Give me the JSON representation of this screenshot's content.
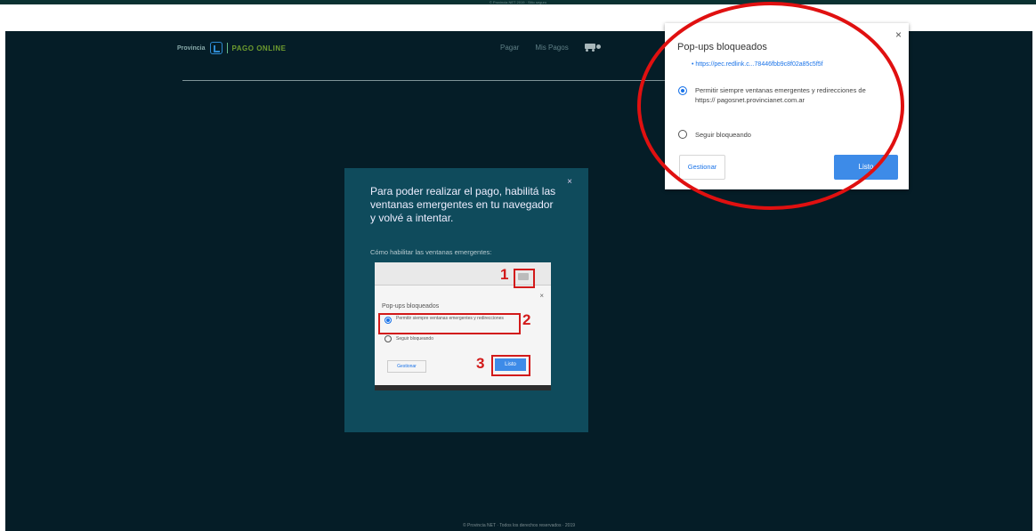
{
  "top_strip": {
    "text": "© Provincia NET 2019 · Sitio seguro"
  },
  "header": {
    "logo_name": "Provincia",
    "product": "PAGO ONLINE",
    "nav": [
      "Pagar",
      "Mis Pagos"
    ]
  },
  "modal": {
    "close": "×",
    "message": "Para poder realizar el pago, habilitá las ventanas emergentes en tu navegador y volvé a intentar.",
    "how_label": "Cómo habilitar las ventanas emergentes:",
    "guide": {
      "title": "Pop-ups bloqueados",
      "option_allow": "Permitir siempre ventanas emergentes y redirecciones",
      "option_block": "Seguir bloqueando",
      "manage": "Gestionar",
      "done": "Listo",
      "close": "×",
      "step_numbers": [
        "1",
        "2",
        "3"
      ]
    }
  },
  "popup": {
    "close": "×",
    "title": "Pop-ups bloqueados",
    "link": "• https://pec.redlink.c...78446fbb9c8f02a85c5f5f",
    "option_allow": "Permitir siempre ventanas emergentes y redirecciones de https:// pagosnet.provincianet.com.ar",
    "option_block": "Seguir bloqueando",
    "manage": "Gestionar",
    "done": "Listo"
  },
  "footer": {
    "text": "© Provincia NET · Todos los derechos reservados · 2019"
  },
  "colors": {
    "page_bg": "#051d27",
    "modal_bg": "#0f4b5c",
    "accent_blue": "#3d8be8",
    "highlight_red": "#e01010",
    "brand_green": "#6e9c2f"
  }
}
